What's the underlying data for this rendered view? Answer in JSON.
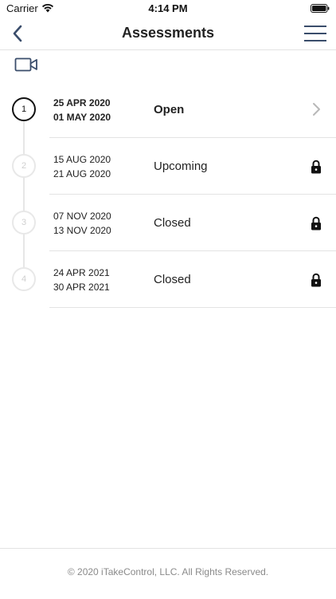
{
  "status_bar": {
    "carrier": "Carrier",
    "time": "4:14 PM",
    "wifi_icon": "wifi-icon",
    "battery_icon": "battery-icon"
  },
  "nav": {
    "title": "Assessments",
    "back_icon": "chevron-left-icon",
    "menu_icon": "hamburger-menu-icon"
  },
  "video_icon": "video-camera-icon",
  "assessments": [
    {
      "step": "1",
      "start": "25 APR 2020",
      "end": "01 MAY 2020",
      "status": "Open",
      "action_icon": "chevron-right-icon",
      "active": true
    },
    {
      "step": "2",
      "start": "15 AUG 2020",
      "end": "21 AUG 2020",
      "status": "Upcoming",
      "action_icon": "lock-icon",
      "active": false
    },
    {
      "step": "3",
      "start": "07 NOV 2020",
      "end": "13 NOV 2020",
      "status": "Closed",
      "action_icon": "lock-icon",
      "active": false
    },
    {
      "step": "4",
      "start": "24 APR 2021",
      "end": "30 APR 2021",
      "status": "Closed",
      "action_icon": "lock-icon",
      "active": false
    }
  ],
  "footer": {
    "copyright": "© 2020 iTakeControl, LLC. All Rights Reserved."
  },
  "colors": {
    "accent": "#3a4d6b",
    "text": "#222222",
    "muted": "#8a8a8a",
    "divider": "#e3e3e3"
  }
}
